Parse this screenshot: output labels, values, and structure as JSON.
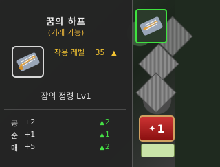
{
  "item": {
    "name": "꿈의 하프",
    "trade_status": "(거래 가능)",
    "requirement_label": "착용 레벨",
    "requirement_value": "35",
    "requirement_indicator": "▲",
    "skill": "잠의 정령 Lv1"
  },
  "stats": [
    {
      "name": "공",
      "value": "+2",
      "change": "2",
      "indicator": "▲"
    },
    {
      "name": "순",
      "value": "+1",
      "change": "1",
      "indicator": "▲"
    },
    {
      "name": "매",
      "value": "+5",
      "change": "2",
      "indicator": "▲"
    }
  ],
  "side_panel": {
    "counter_value": "1"
  },
  "colors": {
    "tooltip_bg": "#242424",
    "title": "#f0f0f0",
    "trade_status": "#e9b43a",
    "requirement": "#f1c232",
    "stat_increase": "#46e046",
    "selected_border": "#3fe23f"
  },
  "icons": {
    "item_icon": "harp-icon",
    "indicator": "up-triangle-icon"
  }
}
